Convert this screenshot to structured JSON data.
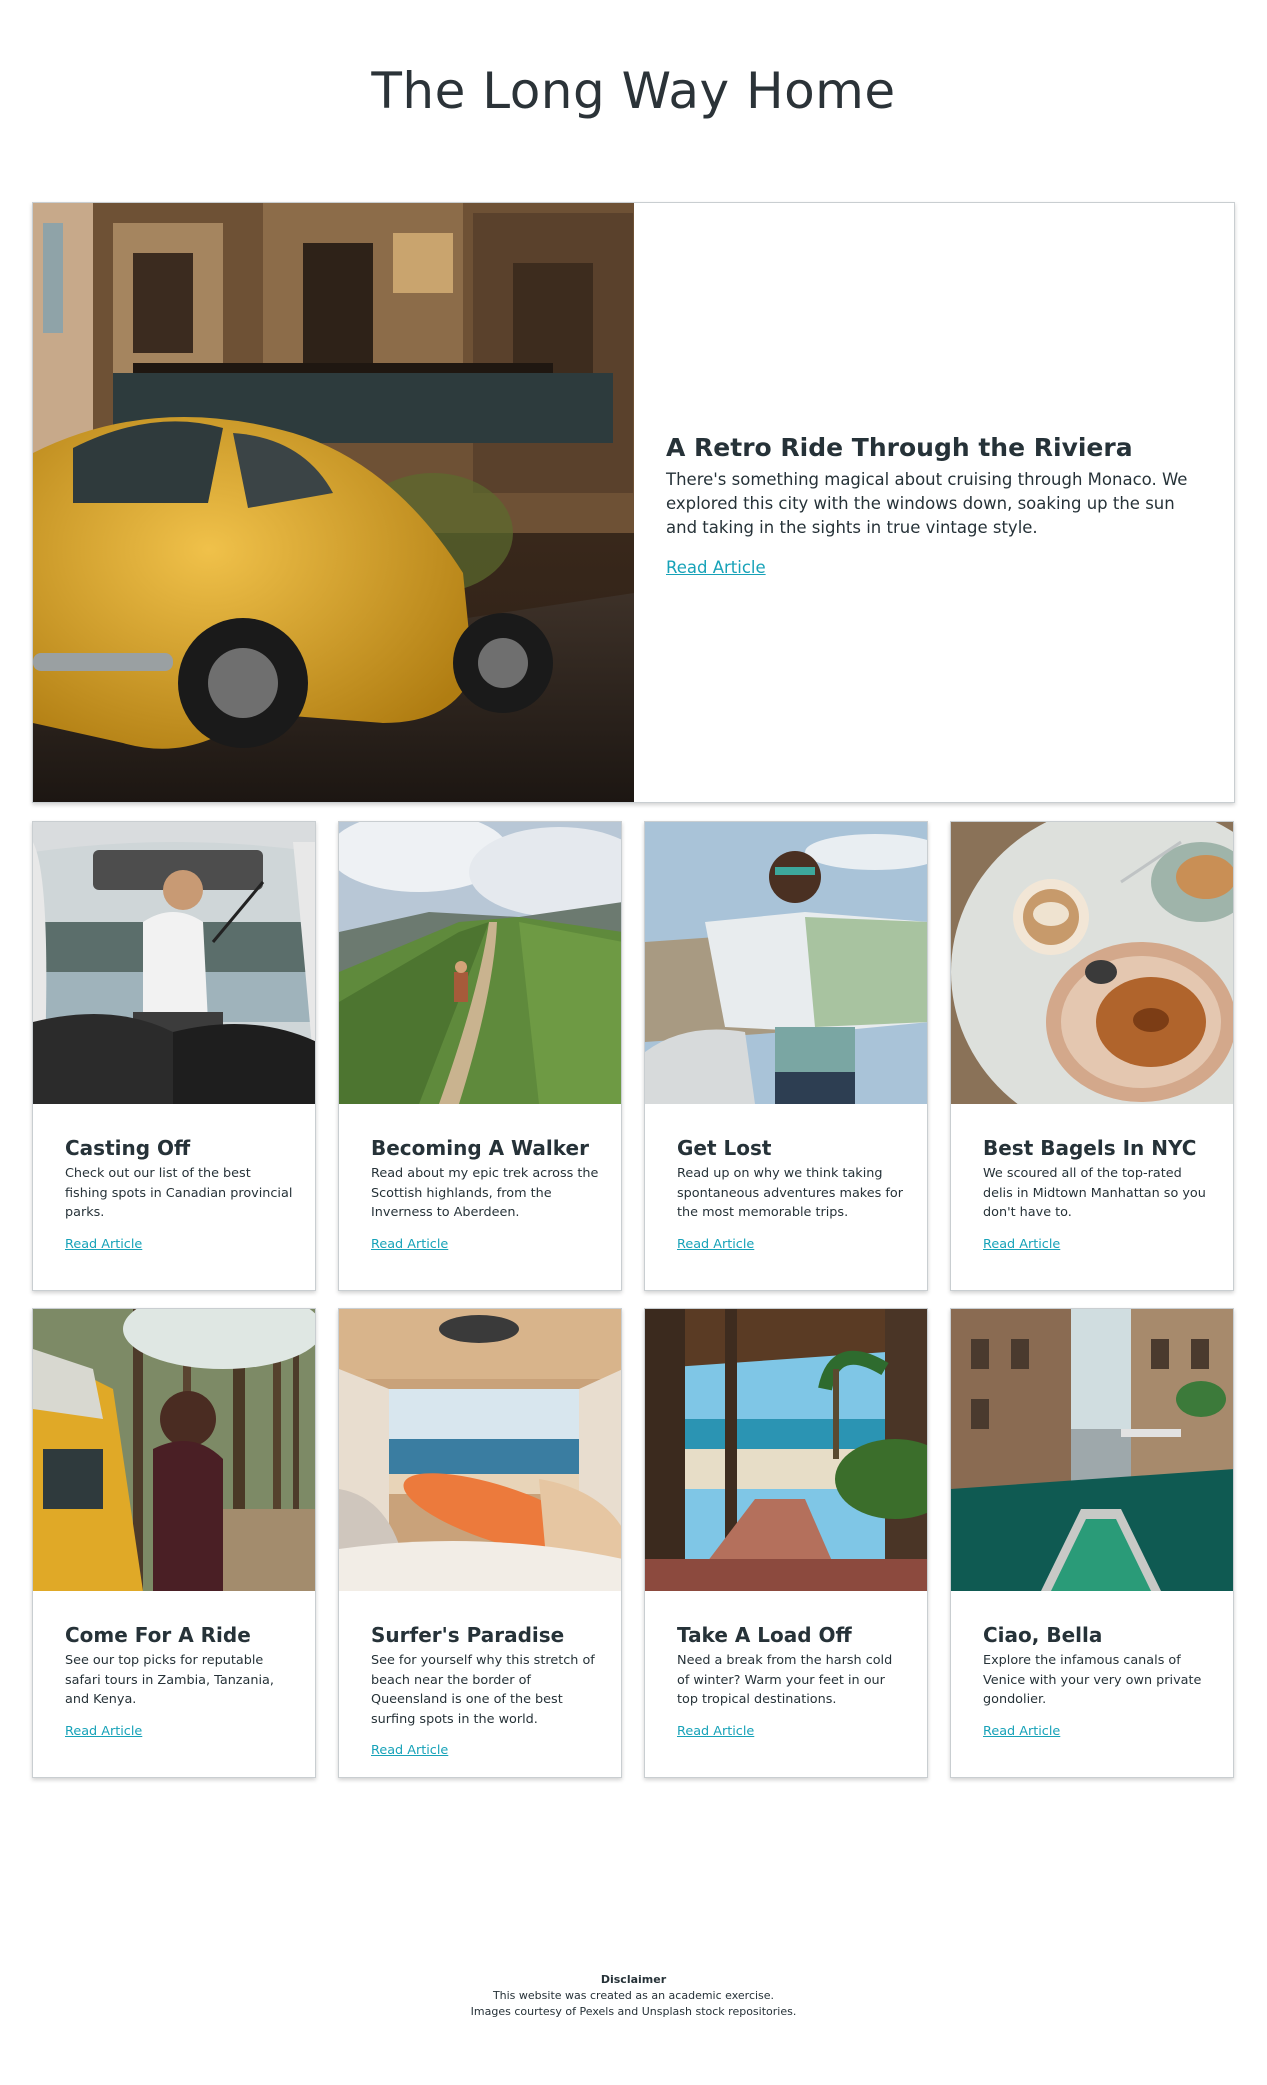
{
  "site": {
    "title": "The Long Way Home"
  },
  "featured": {
    "title": "A Retro Ride Through the Riviera",
    "description": "There's something magical about cruising through Monaco. We explored this city with the windows down, soaking up the sun and taking in the sights in true vintage style.",
    "link": "Read Article",
    "image": "yellow-vintage-car-photo"
  },
  "articles": [
    {
      "title": "Casting Off",
      "description": "Check out our list of the best fishing spots in Canadian provincial parks.",
      "link": "Read Article",
      "image": "fisherman-van-photo"
    },
    {
      "title": "Becoming A Walker",
      "description": "Read about my epic trek across the Scottish highlands, from the Inverness to Aberdeen.",
      "link": "Read Article",
      "image": "highland-ridge-trail-photo"
    },
    {
      "title": "Get Lost",
      "description": "Read up on why we think taking spontaneous adventures makes for the most memorable trips.",
      "link": "Read Article",
      "image": "woman-reading-map-photo"
    },
    {
      "title": "Best Bagels In NYC",
      "description": "We scoured all of the top-rated delis in Midtown Manhattan so you don't have to.",
      "link": "Read Article",
      "image": "bagel-and-coffee-photo"
    },
    {
      "title": "Come For A Ride",
      "description": "See our top picks for reputable safari tours in Zambia, Tanzania, and Kenya.",
      "link": "Read Article",
      "image": "woman-by-yellow-van-photo"
    },
    {
      "title": "Surfer's Paradise",
      "description": "See for yourself why this stretch of beach near the border of Queensland is one of the best surfing spots in the world.",
      "link": "Read Article",
      "image": "van-with-surfboard-beach-photo"
    },
    {
      "title": "Take A Load Off",
      "description": "Need a break from the harsh cold of winter? Warm your feet in our top tropical destinations.",
      "link": "Read Article",
      "image": "tropical-beach-pergola-photo"
    },
    {
      "title": "Ciao, Bella",
      "description": "Explore the infamous canals of Venice with your very own private gondolier.",
      "link": "Read Article",
      "image": "venice-canal-gondola-photo"
    }
  ],
  "footer": {
    "heading": "Disclaimer",
    "line1": "This website was created as an academic exercise.",
    "line2": "Images courtesy of Pexels and Unsplash stock repositories."
  }
}
